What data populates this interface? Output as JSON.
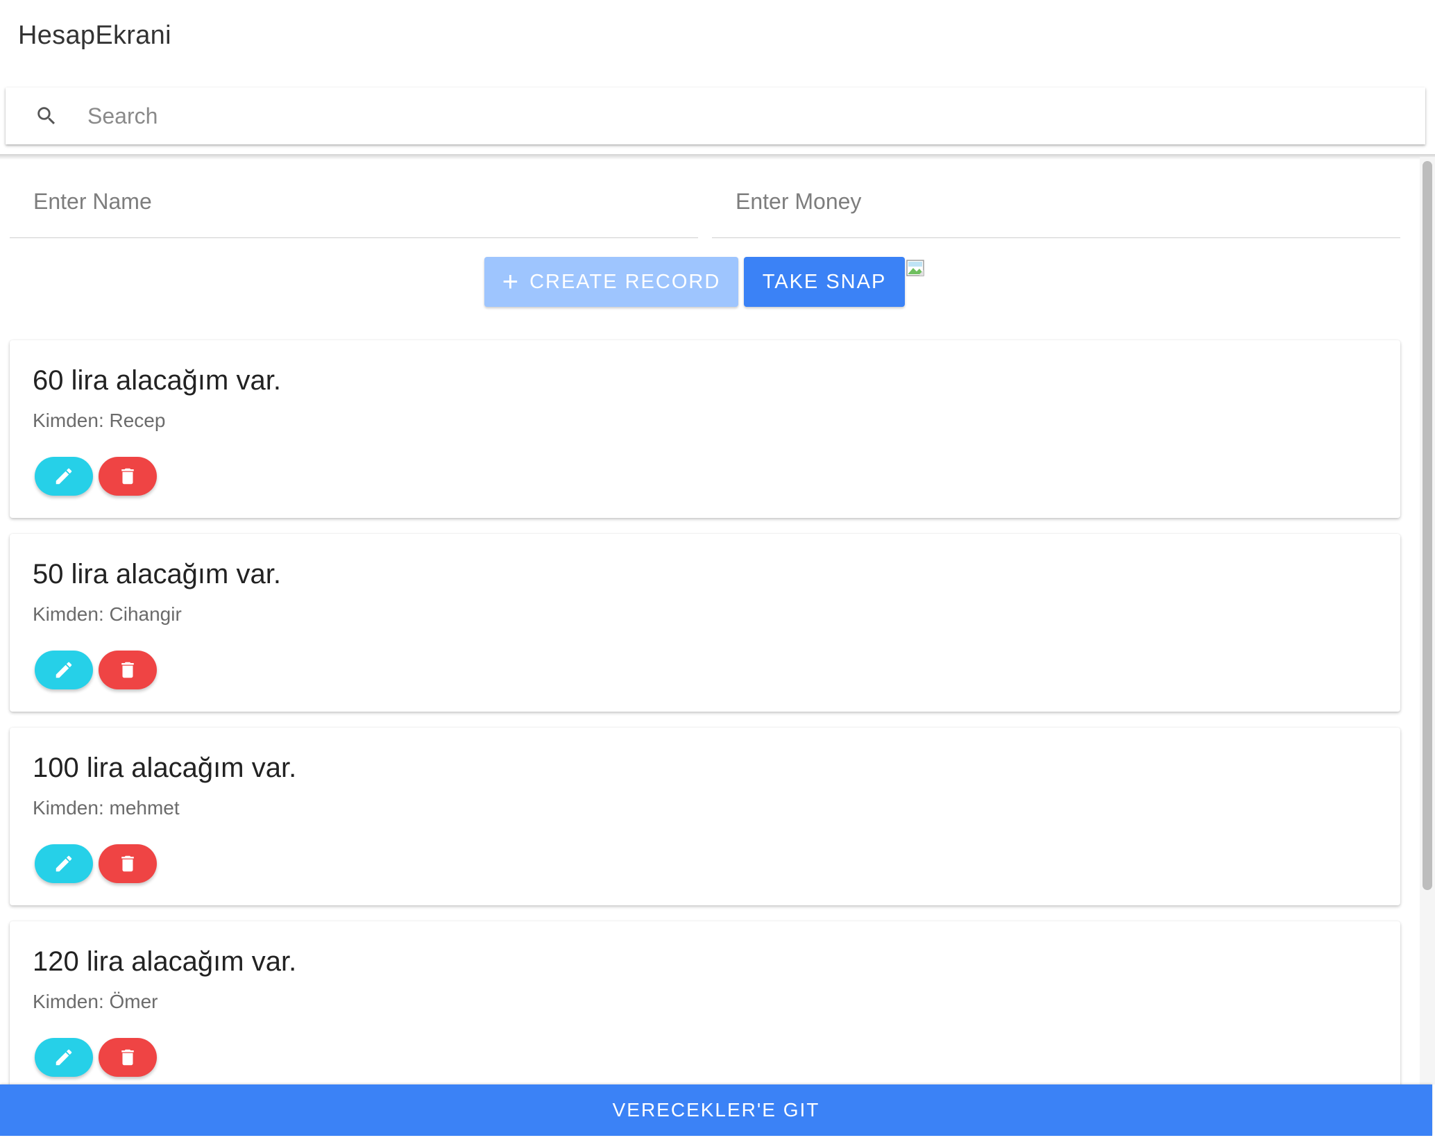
{
  "app": {
    "title": "HesapEkrani"
  },
  "search": {
    "placeholder": "Search",
    "icon": "search-icon"
  },
  "form": {
    "name_placeholder": "Enter Name",
    "money_placeholder": "Enter Money",
    "create_label": "CREATE RECORD",
    "snap_label": "TAKE SNAP",
    "broken_image": "broken-image-icon"
  },
  "records": [
    {
      "title": "60 lira alacağım var.",
      "subtitle": "Kimden: Recep"
    },
    {
      "title": "50 lira alacağım var.",
      "subtitle": "Kimden: Cihangir"
    },
    {
      "title": "100 lira alacağım var.",
      "subtitle": "Kimden: mehmet"
    },
    {
      "title": "120 lira alacağım var.",
      "subtitle": "Kimden: Ömer"
    }
  ],
  "record_actions": {
    "edit_icon": "pencil-icon",
    "delete_icon": "trash-icon"
  },
  "footer": {
    "button_label": "VERECEKLER'E GIT"
  },
  "colors": {
    "primary": "#3b82f6",
    "primary_disabled": "#9ec5fe",
    "edit": "#26d0e8",
    "delete": "#ef4444"
  }
}
